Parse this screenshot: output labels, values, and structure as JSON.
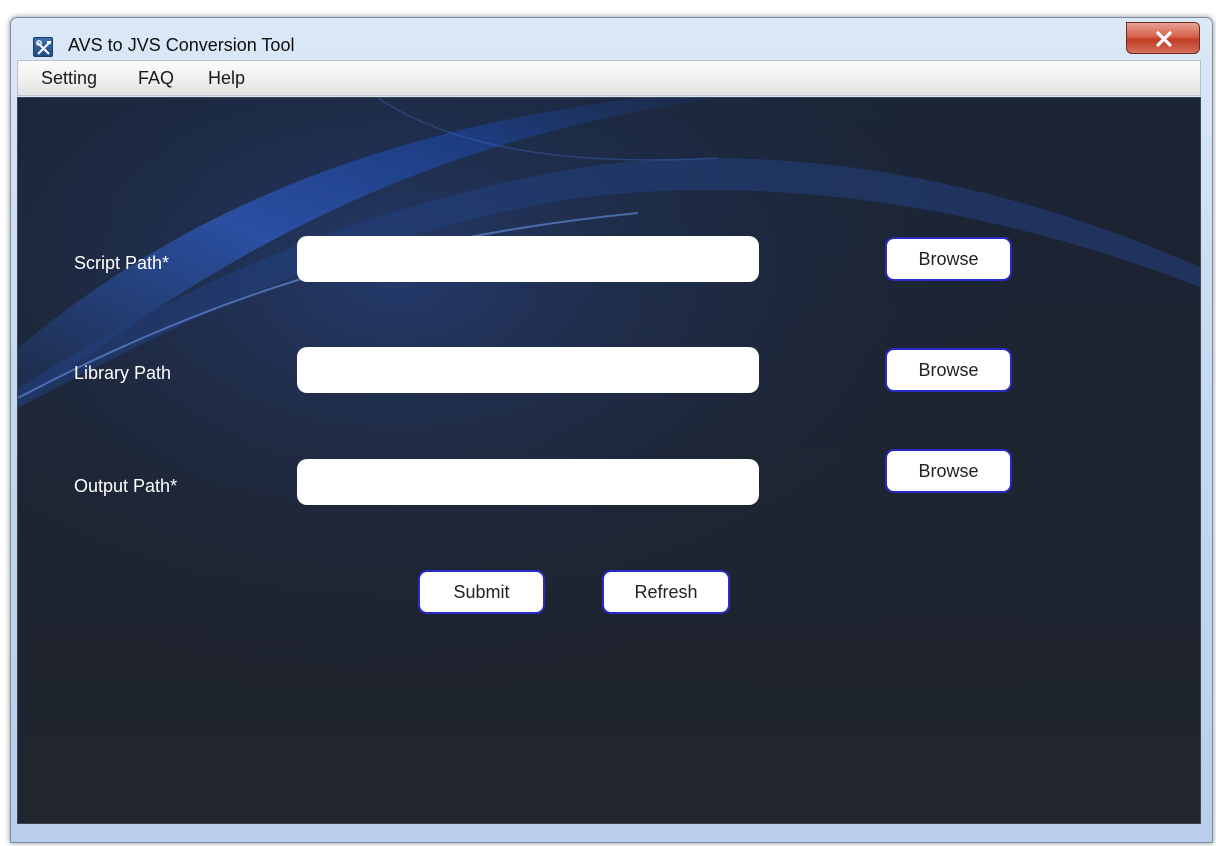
{
  "window": {
    "title": "AVS to JVS Conversion Tool",
    "icon": "tools-icon",
    "close_icon": "close-icon"
  },
  "menu": {
    "items": [
      {
        "label": "Setting"
      },
      {
        "label": "FAQ"
      },
      {
        "label": "Help"
      }
    ]
  },
  "form": {
    "fields": [
      {
        "label": "Script Path*",
        "value": "",
        "browse_label": "Browse"
      },
      {
        "label": "Library Path",
        "value": "",
        "browse_label": "Browse"
      },
      {
        "label": "Output Path*",
        "value": "",
        "browse_label": "Browse"
      }
    ],
    "submit_label": "Submit",
    "refresh_label": "Refresh"
  },
  "colors": {
    "background": "#1d2431",
    "accent_blue": "#2f5fcf",
    "button_border": "#2a2ac8"
  }
}
